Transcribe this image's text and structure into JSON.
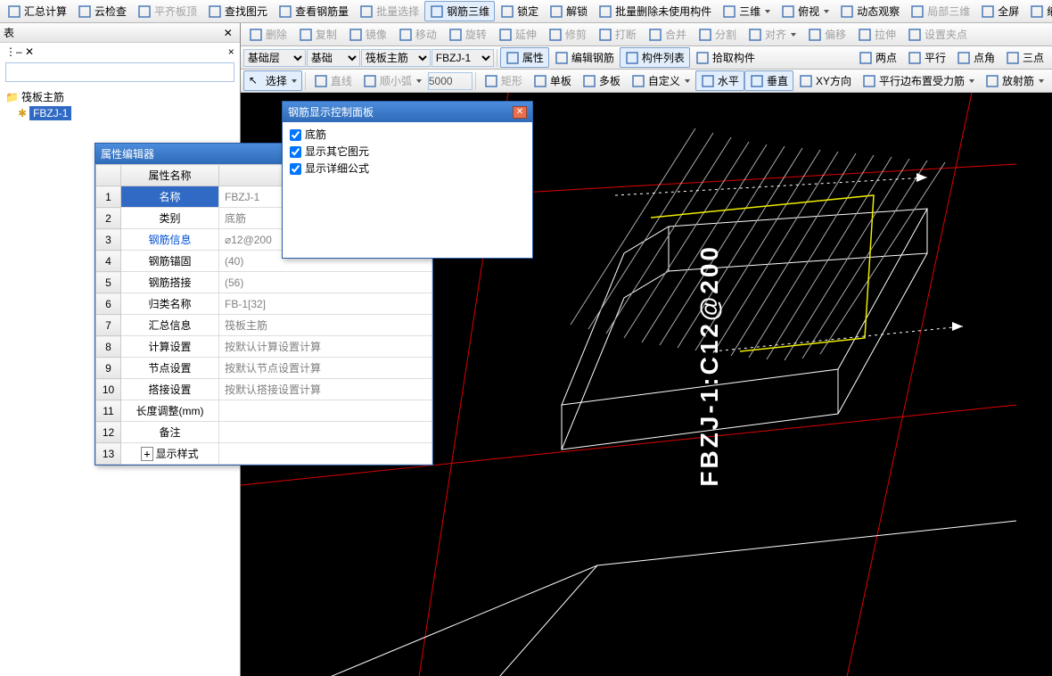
{
  "topbar": [
    {
      "id": "sum-calc",
      "label": "汇总计算",
      "disabled": false
    },
    {
      "id": "cloud-check",
      "label": "云检查",
      "disabled": false
    },
    {
      "id": "flat-slab",
      "label": "平齐板顶",
      "disabled": true
    },
    {
      "id": "find-elem",
      "label": "查找图元",
      "disabled": false
    },
    {
      "id": "view-rebar",
      "label": "查看钢筋量",
      "disabled": false
    },
    {
      "id": "batch-sel",
      "label": "批量选择",
      "disabled": true
    },
    {
      "id": "rebar-3d",
      "label": "钢筋三维",
      "active": true
    },
    {
      "id": "lock",
      "label": "锁定",
      "disabled": false
    },
    {
      "id": "unlock",
      "label": "解锁",
      "disabled": false
    },
    {
      "id": "batch-del",
      "label": "批量删除未使用构件",
      "disabled": false
    },
    {
      "id": "view-3d",
      "label": "三维",
      "dd": true
    },
    {
      "id": "top-view",
      "label": "俯视",
      "dd": true
    },
    {
      "id": "dyn-obs",
      "label": "动态观察",
      "disabled": false
    },
    {
      "id": "local-3d",
      "label": "局部三维",
      "disabled": true
    },
    {
      "id": "fullscreen",
      "label": "全屏",
      "disabled": false
    },
    {
      "id": "zoom",
      "label": "缩放",
      "dd": true
    }
  ],
  "left": {
    "title": "表",
    "close": "✕",
    "nodeClose": "×",
    "search_ph": "",
    "tree_root": "筏板主筋",
    "tree_item": "FBZJ-1"
  },
  "tb1": [
    {
      "id": "delete",
      "label": "删除",
      "disabled": true
    },
    {
      "id": "copy",
      "label": "复制",
      "disabled": true
    },
    {
      "id": "mirror",
      "label": "镜像",
      "disabled": true
    },
    {
      "id": "move",
      "label": "移动",
      "disabled": true
    },
    {
      "id": "rotate",
      "label": "旋转",
      "disabled": true
    },
    {
      "id": "extend",
      "label": "延伸",
      "disabled": true
    },
    {
      "id": "trim",
      "label": "修剪",
      "disabled": true
    },
    {
      "id": "break",
      "label": "打断",
      "disabled": true
    },
    {
      "id": "merge",
      "label": "合并",
      "disabled": true
    },
    {
      "id": "split",
      "label": "分割",
      "disabled": true
    },
    {
      "id": "align",
      "label": "对齐",
      "disabled": true,
      "dd": true
    },
    {
      "id": "offset",
      "label": "偏移",
      "disabled": true
    },
    {
      "id": "stretch",
      "label": "拉伸",
      "disabled": true
    },
    {
      "id": "pivot",
      "label": "设置夹点",
      "disabled": true
    }
  ],
  "tb2": {
    "floors": "基础层",
    "category": "基础",
    "type": "筏板主筋",
    "component": "FBZJ-1",
    "buttons": [
      {
        "id": "props",
        "label": "属性",
        "active": true
      },
      {
        "id": "edit-rebar",
        "label": "编辑钢筋"
      },
      {
        "id": "comp-list",
        "label": "构件列表",
        "active": true
      },
      {
        "id": "pick",
        "label": "拾取构件"
      }
    ],
    "right": [
      {
        "id": "two-pt",
        "label": "两点"
      },
      {
        "id": "parallel",
        "label": "平行"
      },
      {
        "id": "pt-angle",
        "label": "点角"
      },
      {
        "id": "three-pt",
        "label": "三点"
      }
    ]
  },
  "tb3": {
    "select": "选择",
    "items": [
      {
        "id": "line",
        "label": "直线",
        "disabled": true
      },
      {
        "id": "arc",
        "label": "顺小弧",
        "disabled": true,
        "dd": true
      }
    ],
    "num": "5000",
    "items2": [
      {
        "id": "rect",
        "label": "矩形",
        "disabled": true
      },
      {
        "id": "single",
        "label": "单板"
      },
      {
        "id": "multi",
        "label": "多板"
      },
      {
        "id": "custom",
        "label": "自定义",
        "dd": true
      },
      {
        "id": "horiz",
        "label": "水平",
        "active": true
      },
      {
        "id": "vert",
        "label": "垂直",
        "active": true
      },
      {
        "id": "xy",
        "label": "XY方向"
      },
      {
        "id": "parallel-rebar",
        "label": "平行边布置受力筋",
        "dd": true
      },
      {
        "id": "radial",
        "label": "放射筋",
        "dd": true
      }
    ]
  },
  "prop": {
    "title": "属性编辑器",
    "headers": [
      "",
      "属性名称",
      ""
    ],
    "rows": [
      {
        "n": "1",
        "name": "名称",
        "val": "FBZJ-1",
        "sel": true
      },
      {
        "n": "2",
        "name": "类别",
        "val": "底筋"
      },
      {
        "n": "3",
        "name": "钢筋信息",
        "val": "⌀12@200",
        "link": true
      },
      {
        "n": "4",
        "name": "钢筋锚固",
        "val": "(40)"
      },
      {
        "n": "5",
        "name": "钢筋搭接",
        "val": "(56)"
      },
      {
        "n": "6",
        "name": "归类名称",
        "val": "FB-1[32]"
      },
      {
        "n": "7",
        "name": "汇总信息",
        "val": "筏板主筋"
      },
      {
        "n": "8",
        "name": "计算设置",
        "val": "按默认计算设置计算"
      },
      {
        "n": "9",
        "name": "节点设置",
        "val": "按默认节点设置计算"
      },
      {
        "n": "10",
        "name": "搭接设置",
        "val": "按默认搭接设置计算"
      },
      {
        "n": "11",
        "name": "长度调整(mm)",
        "val": ""
      },
      {
        "n": "12",
        "name": "备注",
        "val": ""
      },
      {
        "n": "13",
        "name": "显示样式",
        "val": "",
        "exp": true
      }
    ]
  },
  "ctl": {
    "title": "钢筋显示控制面板",
    "items": [
      "底筋",
      "显示其它图元",
      "显示详细公式"
    ]
  },
  "viewport_label": "FBZJ-1:C12@200"
}
